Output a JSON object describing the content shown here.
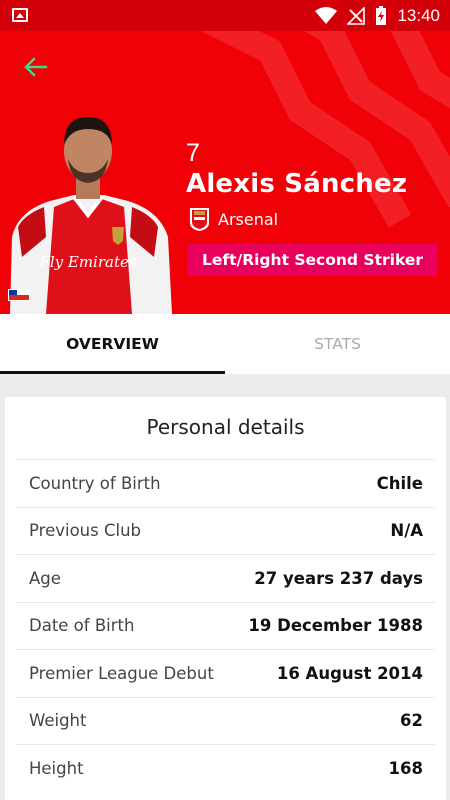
{
  "status_bar": {
    "time": "13:40",
    "icons": [
      "gallery-icon",
      "wifi-icon",
      "no-signal-icon",
      "battery-charging-icon"
    ]
  },
  "colors": {
    "hero_red": "#ef0107",
    "status_red": "#d3000a",
    "position_pink": "#e9005c",
    "back_arrow_green": "#3cdc8c"
  },
  "player": {
    "number": "7",
    "name": "Alexis Sánchez",
    "club": "Arsenal",
    "position": "Left/Right Second Striker",
    "nationality_flag": "chile-flag-icon",
    "shirt_text": "Fly Emirates"
  },
  "tabs": [
    {
      "label": "OVERVIEW",
      "active": true
    },
    {
      "label": "STATS",
      "active": false
    }
  ],
  "personal_details": {
    "title": "Personal details",
    "rows": [
      {
        "label": "Country of Birth",
        "value": "Chile"
      },
      {
        "label": "Previous Club",
        "value": "N/A"
      },
      {
        "label": "Age",
        "value": "27 years 237 days"
      },
      {
        "label": "Date of Birth",
        "value": "19 December 1988"
      },
      {
        "label": "Premier League Debut",
        "value": "16 August 2014"
      },
      {
        "label": "Weight",
        "value": "62"
      },
      {
        "label": "Height",
        "value": "168"
      }
    ]
  }
}
